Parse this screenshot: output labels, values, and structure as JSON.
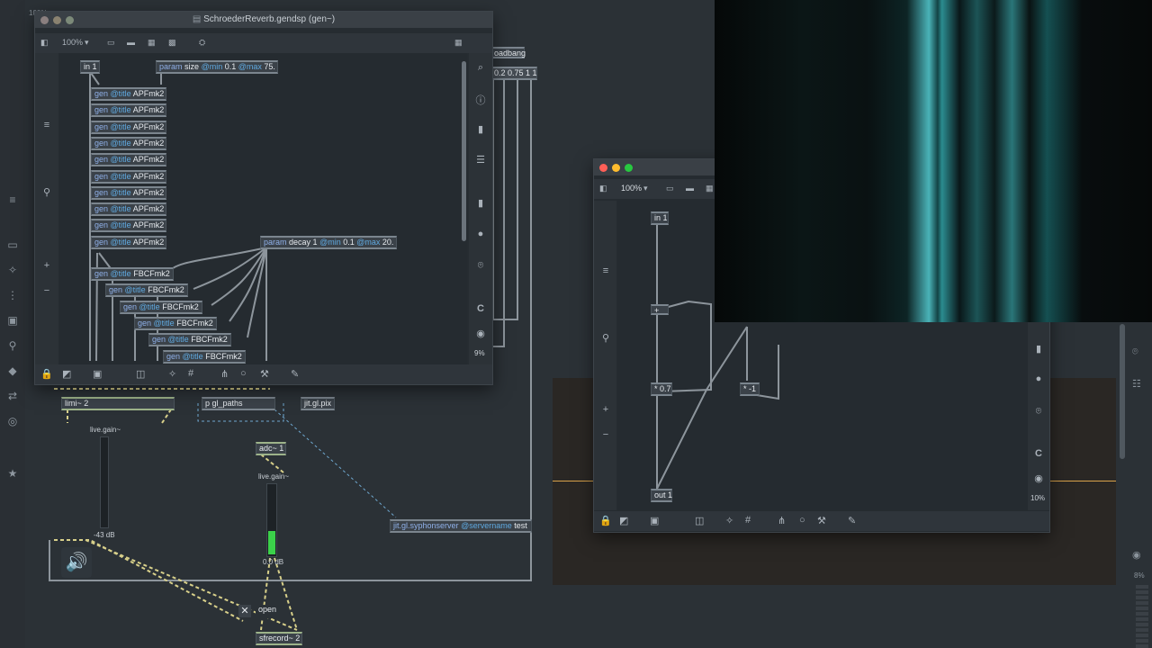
{
  "app": {
    "zoom_bg": "100%"
  },
  "gen_window": {
    "title": "SchroederReverb.gendsp (gen~)",
    "zoom": "100%",
    "inlet": "in 1",
    "param_size": {
      "name": "param",
      "arg": "size",
      "min_kw": "@min",
      "min": "0.1",
      "max_kw": "@max",
      "max": "75."
    },
    "param_decay": {
      "name": "param",
      "arg": "decay 1",
      "min_kw": "@min",
      "min": "0.1",
      "max_kw": "@max",
      "max": "20."
    },
    "apf_objects": [
      "APFmk2",
      "APFmk2",
      "APFmk2",
      "APFmk2",
      "APFmk2",
      "APFmk2",
      "APFmk2",
      "APFmk2",
      "APFmk2",
      "APFmk2"
    ],
    "fbcf_objects": [
      "FBCFmk2",
      "FBCFmk2",
      "FBCFmk2",
      "FBCFmk2",
      "FBCFmk2",
      "FBCFmk2"
    ],
    "gen_kw": "gen",
    "title_kw": "@title",
    "cpu": "9%"
  },
  "small_window": {
    "zoom": "100%",
    "inlet": "in 1",
    "plus": "+",
    "mul1": "* 0.7",
    "mul2": "* -1",
    "outlet": "out 1",
    "cpu": "10%"
  },
  "main_patch": {
    "loadbang": "oadbang",
    "msg": "0.2 0.75 1 1",
    "limi": "limi~ 2",
    "gl_paths": "p gl_paths",
    "jit_gl_pix": "jit.gl.pix",
    "live_gain1": "live.gain~",
    "gain1_val": "-43 dB",
    "adc": "adc~ 1",
    "live_gain2": "live.gain~",
    "gain2_val": "0.0 dB",
    "syphon": {
      "name": "jit.gl.syphonserver",
      "kw": "@servername",
      "val": "test"
    },
    "open_msg": "open",
    "sfrecord": "sfrecord~ 2",
    "right_cpu": "8%"
  },
  "colors": {
    "accent": "#5fa9e0",
    "meter": "#3bd14a"
  }
}
